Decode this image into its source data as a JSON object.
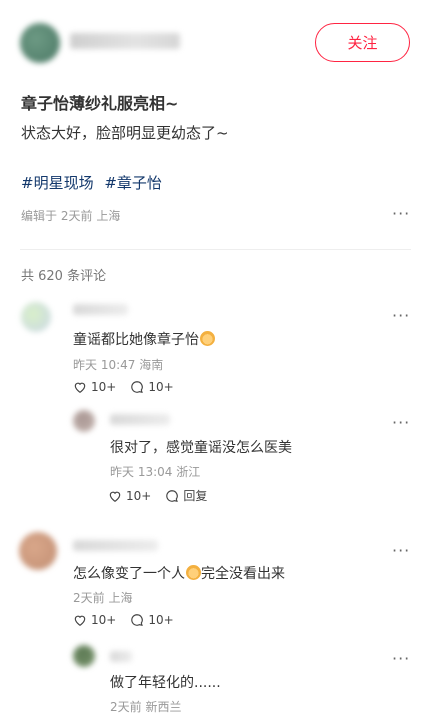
{
  "header": {
    "follow_label": "关注"
  },
  "post": {
    "title": "章子怡薄纱礼服亮相~",
    "body": "状态大好，脸部明显更幼态了~",
    "tags": [
      "#明星现场",
      "#章子怡"
    ],
    "edited": "编辑于",
    "time": "2天前",
    "location": "上海"
  },
  "comments_header": "共 620 条评论",
  "comments": [
    {
      "text": "童谣都比她像章子怡",
      "time": "昨天 10:47",
      "location": "海南",
      "likes": "10+",
      "replies": "10+"
    },
    {
      "text": "很对了，感觉童谣没怎么医美",
      "time": "昨天 13:04",
      "location": "浙江",
      "likes": "10+",
      "reply_label": "回复"
    },
    {
      "text_before": "怎么像变了一个人",
      "text_after": "完全没看出来",
      "time": "2天前",
      "location": "上海",
      "likes": "10+",
      "replies": "10+"
    },
    {
      "text": "做了年轻化的......",
      "time": "2天前",
      "location": "新西兰"
    }
  ],
  "icons": {
    "more": "more-icon",
    "like": "heart-icon",
    "reply": "comment-bubble-icon"
  },
  "colors": {
    "accent": "#ff2442",
    "tag": "#13386c"
  }
}
